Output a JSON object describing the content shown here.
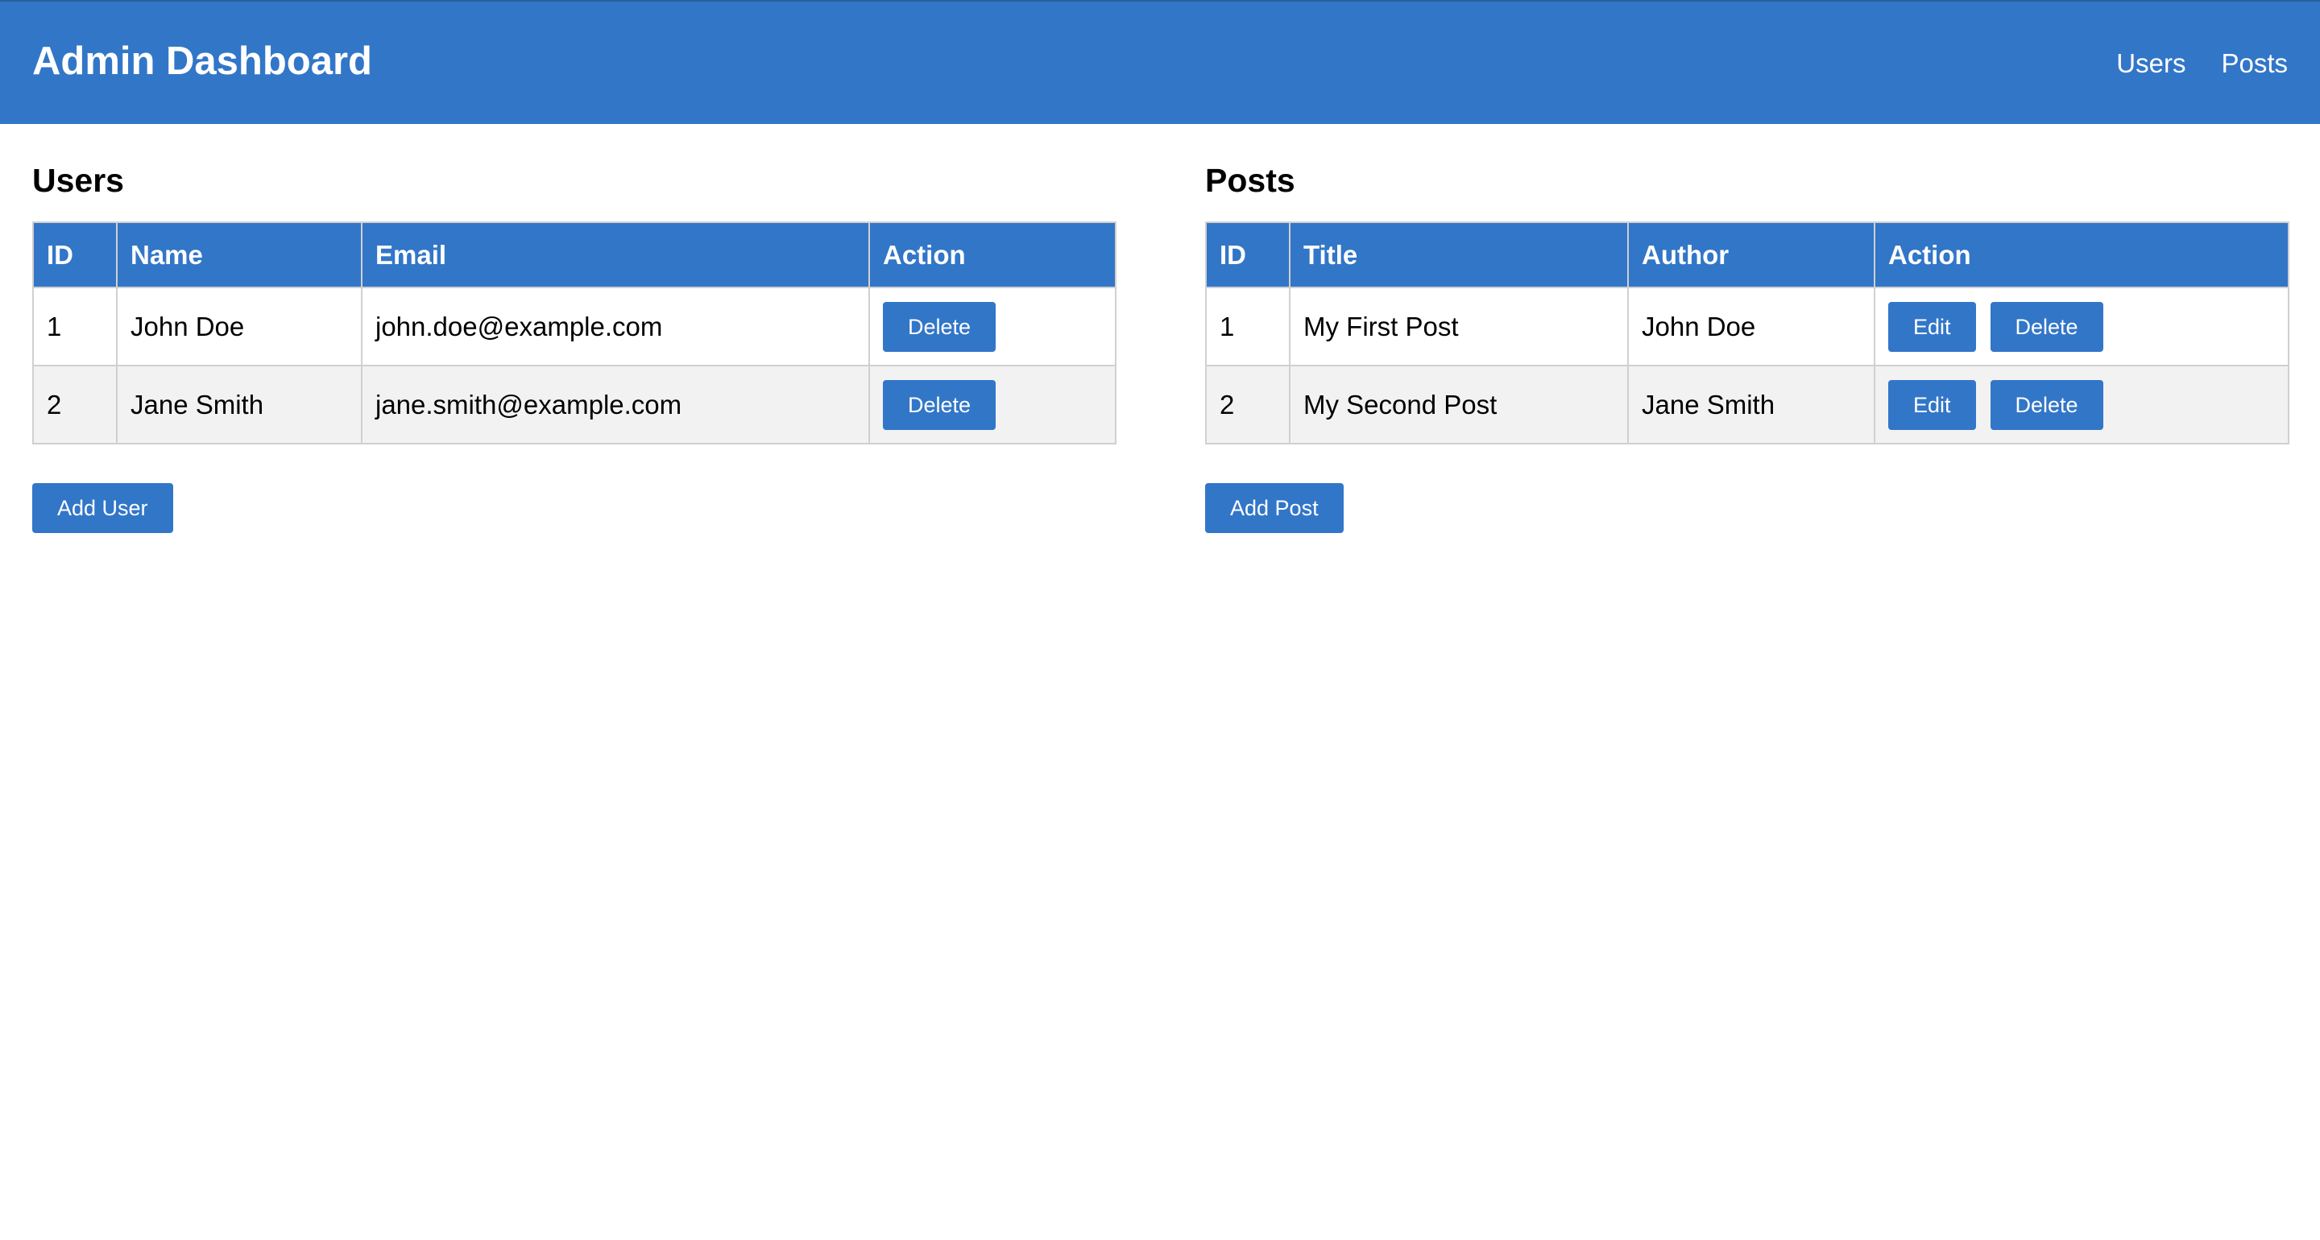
{
  "header": {
    "title": "Admin Dashboard",
    "nav": [
      {
        "label": "Users"
      },
      {
        "label": "Posts"
      }
    ]
  },
  "users": {
    "title": "Users",
    "columns": [
      "ID",
      "Name",
      "Email",
      "Action"
    ],
    "rows": [
      {
        "id": "1",
        "name": "John Doe",
        "email": "john.doe@example.com",
        "delete_label": "Delete"
      },
      {
        "id": "2",
        "name": "Jane Smith",
        "email": "jane.smith@example.com",
        "delete_label": "Delete"
      }
    ],
    "add_label": "Add User"
  },
  "posts": {
    "title": "Posts",
    "columns": [
      "ID",
      "Title",
      "Author",
      "Action"
    ],
    "rows": [
      {
        "id": "1",
        "title": "My First Post",
        "author": "John Doe",
        "edit_label": "Edit",
        "delete_label": "Delete"
      },
      {
        "id": "2",
        "title": "My Second Post",
        "author": "Jane Smith",
        "edit_label": "Edit",
        "delete_label": "Delete"
      }
    ],
    "add_label": "Add Post"
  },
  "colors": {
    "accent": "#3276c8",
    "row_alt": "#f2f2f2",
    "border": "#d0d0d0"
  }
}
